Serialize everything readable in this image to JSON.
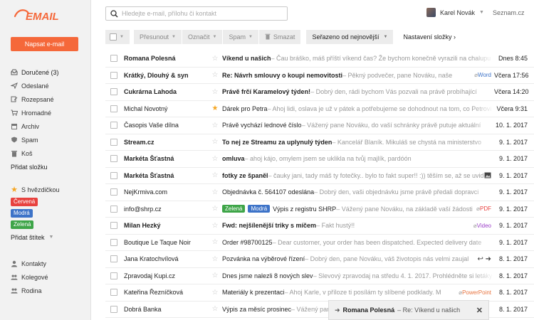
{
  "app": {
    "logo_text": "EMAIL",
    "compose_label": "Napsat e-mail",
    "accent": "#f5683a"
  },
  "search": {
    "placeholder": "Hledejte e-mail, přílohu či kontakt"
  },
  "user": {
    "name": "Karel Novák",
    "brand": "Seznam.cz"
  },
  "sidebar": {
    "folders": [
      {
        "label": "Doručené (3)",
        "icon": "inbox-icon"
      },
      {
        "label": "Odeslané",
        "icon": "send-icon"
      },
      {
        "label": "Rozepsané",
        "icon": "draft-icon"
      },
      {
        "label": "Hromadné",
        "icon": "cart-icon"
      },
      {
        "label": "Archiv",
        "icon": "archive-icon"
      },
      {
        "label": "Spam",
        "icon": "spam-icon"
      },
      {
        "label": "Koš",
        "icon": "trash-icon"
      }
    ],
    "add_folder": "Přidat složku",
    "starred": "S hvězdičkou",
    "labels": [
      {
        "label": "Červená",
        "color": "#e8423f"
      },
      {
        "label": "Modrá",
        "color": "#3d73c8"
      },
      {
        "label": "Zelená",
        "color": "#3ea548"
      }
    ],
    "add_label": "Přidat štítek",
    "contacts": [
      {
        "label": "Kontakty"
      },
      {
        "label": "Kolegové"
      },
      {
        "label": "Rodina"
      }
    ]
  },
  "toolbar": {
    "move": "Přesunout",
    "mark": "Označit",
    "spam": "Spam",
    "delete": "Smazat",
    "sort": "Seřazeno od nejnovější",
    "folder_settings": "Nastavení složky ›"
  },
  "emails": [
    {
      "sender": "Romana Polesná",
      "subject": "Víkend u našich",
      "preview": " – Čau bráško, máš příští víkend čas? Že bychom konečně vyrazili na chalupu",
      "date": "Dnes 8:45",
      "unread": true,
      "starred": false
    },
    {
      "sender": "Krátký, Dlouhý & syn",
      "subject": "Re: Návrh smlouvy o koupi nemovitosti",
      "preview": " – Pěkný podvečer, pane Nováku, naše",
      "date": "Včera 17:56",
      "unread": true,
      "starred": false,
      "attachment": {
        "type": "Word",
        "color": "#3d73c8"
      }
    },
    {
      "sender": "Cukrárna Lahoda",
      "subject": "Právě frčí Karamelový týden!",
      "preview": " – Dobrý den, rádi bychom Vás pozvali na právě probíhající",
      "date": "Včera 14:20",
      "unread": true,
      "starred": false
    },
    {
      "sender": "Michal Novotný",
      "subject": "Dárek pro Petra",
      "preview": " – Ahoj lidi, oslava je už v pátek a potřebujeme se dohodnout na tom, co Petrovi",
      "date": "Včera 9:31",
      "unread": false,
      "starred": true
    },
    {
      "sender": "Časopis Vaše dílna",
      "subject": "Právě vychází lednové číslo",
      "preview": " – Vážený pane Nováku, do vaší schránky právě putuje aktuální",
      "date": "10. 1. 2017",
      "unread": false,
      "starred": false
    },
    {
      "sender": "Stream.cz",
      "subject": "To nej ze Streamu za uplynulý týden",
      "preview": " – Kancelář Blaník. Mikuláš se chystá na ministerstvo",
      "date": "9. 1. 2017",
      "unread": true,
      "starred": false
    },
    {
      "sender": "Markéta Šťastná",
      "subject": "omluva",
      "preview": " – ahoj kájo,  omylem jsem se uklikla na tvůj majlík, pardóón",
      "date": "9. 1. 2017",
      "unread": true,
      "starred": false
    },
    {
      "sender": "Markéta Šťastná",
      "subject": "fotky ze španěl",
      "preview": " – čauky jani, tady máš ty fotečky.. bylo to fakt super!! :)) těším se, až se uvidíme",
      "date": "9. 1. 2017",
      "unread": true,
      "starred": false,
      "image_icon": true
    },
    {
      "sender": "NejKrmiva.com",
      "subject": "Objednávka č. 564107 odeslána",
      "preview": " – Dobrý den, vaši objednávku jsme právě předali dopravci",
      "date": "9. 1. 2017",
      "unread": false,
      "starred": false
    },
    {
      "sender": "info@shrp.cz",
      "subject": "Výpis z registru SHRP",
      "preview": " – Vážený pane Nováku, na základě vaší žádosti",
      "date": "9. 1. 2017",
      "unread": false,
      "starred": false,
      "tags": [
        {
          "label": "Zelená",
          "color": "#3ea548"
        },
        {
          "label": "Modrá",
          "color": "#3d73c8"
        }
      ],
      "attachment": {
        "type": "PDF",
        "color": "#e8423f"
      }
    },
    {
      "sender": "Milan Hezký",
      "subject": "Fwd: nejšílenější triky s míčem",
      "preview": " – Fakt hustý!!",
      "date": "9. 1. 2017",
      "unread": true,
      "starred": false,
      "attachment": {
        "type": "Video",
        "color": "#9b3ec8"
      }
    },
    {
      "sender": "Boutique Le Taque Noir",
      "subject": "Order #98700125",
      "preview": " – Dear customer, your order has been dispatched.  Expected delivery date",
      "date": "9. 1. 2017",
      "unread": false,
      "starred": false
    },
    {
      "sender": "Jana Kratochvílová",
      "subject": "Pozvánka na výběrové řízení",
      "preview": " – Dobrý den, pane Nováku, váš životopis nás velmi zaujal",
      "date": "8. 1. 2017",
      "unread": false,
      "starred": false,
      "replied": true
    },
    {
      "sender": "Zpravodaj Kupi.cz",
      "subject": "Dnes jsme nalezli 8 nových slev",
      "preview": " – Slevový zpravodaj na středu 4. 1. 2017. Prohlédněte si letáky",
      "date": "8. 1. 2017",
      "unread": false,
      "starred": false
    },
    {
      "sender": "Kateřina Řezníčková",
      "subject": "Materiály k prezentaci",
      "preview": " – Ahoj Karle, v příloze ti posílám ty slíbené podklady. M",
      "date": "8. 1. 2017",
      "unread": false,
      "starred": false,
      "attachment": {
        "type": "PowerPoint",
        "color": "#e8743f"
      }
    },
    {
      "sender": "Dobrá Banka",
      "subject": "Výpis za měsíc prosinec",
      "preview": " – Vážený pane Nováku, zasíláme Vám výpis",
      "date": "8. 1. 2017",
      "unread": false,
      "starred": false
    }
  ],
  "toast": {
    "prefix": "➜",
    "sender": "Romana Polesná",
    "text": "– Re: Víkend u našich"
  }
}
